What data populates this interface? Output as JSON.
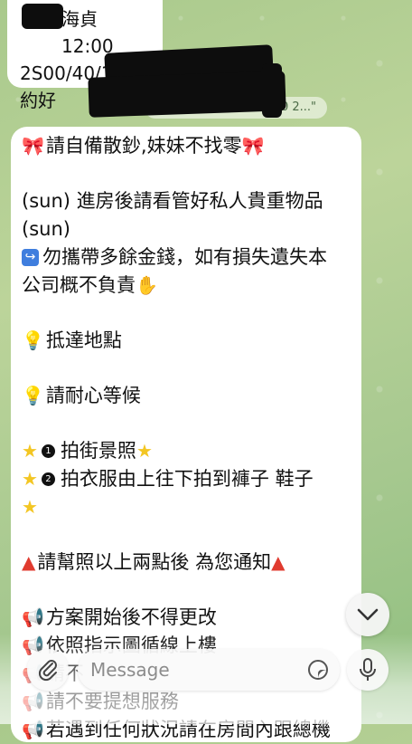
{
  "top_message": {
    "line1_visible": "海貞 12:00",
    "line2": "2S00/40/1S",
    "line3": "約好"
  },
  "quote_preview": "00 2...\"",
  "main_message": {
    "lines": [
      {
        "icon": "bow",
        "text": "請自備散鈔,妹妹不找零",
        "trail": "bow"
      },
      {
        "gap": true
      },
      {
        "text": "(sun) 進房後請看管好私人貴重物品"
      },
      {
        "text": "(sun)"
      },
      {
        "icon": "arrow",
        "text": "勿攜帶多餘金錢，如有損失遺失本"
      },
      {
        "text": "公司概不負責",
        "trail": "hand"
      },
      {
        "gap": true
      },
      {
        "icon": "bulb",
        "text": "抵達地點"
      },
      {
        "gap": true
      },
      {
        "icon": "bulb",
        "text": "請耐心等候"
      },
      {
        "gap": true
      },
      {
        "icon": "star",
        "num": "1",
        "text": "拍街景照",
        "trail": "star"
      },
      {
        "icon": "star",
        "num": "2",
        "text": "拍衣服由上往下拍到褲子 鞋子"
      },
      {
        "icon": "star",
        "text": ""
      },
      {
        "gap": true
      },
      {
        "icon": "tri",
        "text": "請幫照以上兩點後 為您通知",
        "trail": "tri"
      },
      {
        "gap": true
      },
      {
        "icon": "mega",
        "text": "方案開始後不得更改"
      },
      {
        "icon": "mega",
        "text": "依照指示圖循線上樓"
      },
      {
        "icon": "mega",
        "text": "請不"
      },
      {
        "icon": "mega",
        "text": "請不要提想服務"
      },
      {
        "icon": "mega",
        "text": "若遇到任何狀況請在房間內跟總機"
      }
    ]
  },
  "input": {
    "placeholder": "Message"
  },
  "icons": {
    "attach": "paperclip-icon",
    "sticker": "sticker-icon",
    "mic": "microphone-icon",
    "scroll": "chevron-down-icon"
  }
}
